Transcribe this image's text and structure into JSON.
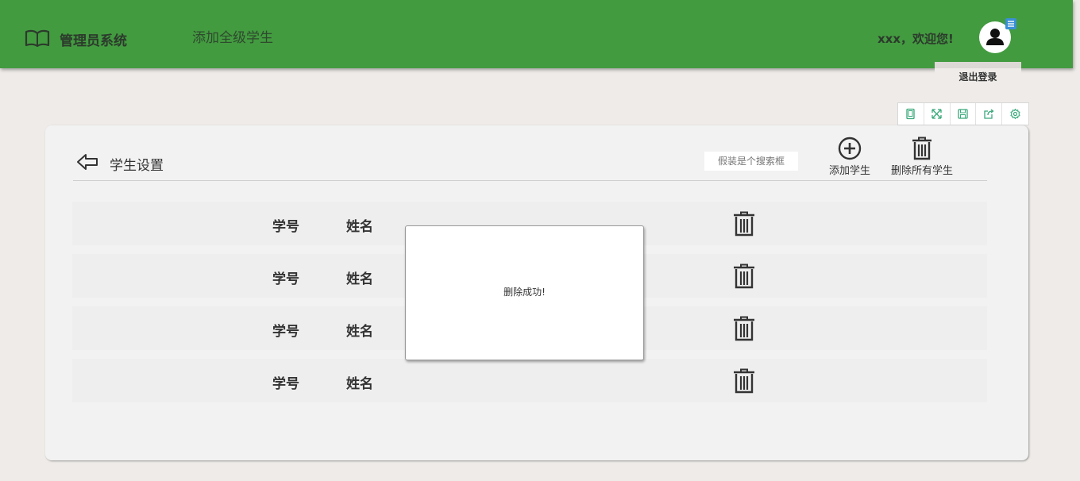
{
  "header": {
    "app_title": "管理员系统",
    "page_heading": "添加全级学生",
    "greeting": "xxx，欢迎您!",
    "logout_label": "退出登录",
    "colors": {
      "header_bg": "#439b40",
      "badge": "#3a8fd6"
    }
  },
  "toolbar": {
    "icons": [
      "tablet-icon",
      "expand-icon",
      "save-icon",
      "share-icon",
      "settings-icon"
    ]
  },
  "panel": {
    "title": "学生设置",
    "search_placeholder": "假装是个搜索框",
    "add_label": "添加学生",
    "delete_all_label": "删除所有学生"
  },
  "rows": [
    {
      "id_label": "学号",
      "name_label": "姓名"
    },
    {
      "id_label": "学号",
      "name_label": "姓名"
    },
    {
      "id_label": "学号",
      "name_label": "姓名"
    },
    {
      "id_label": "学号",
      "name_label": "姓名"
    }
  ],
  "toast": {
    "message": "删除成功!"
  }
}
